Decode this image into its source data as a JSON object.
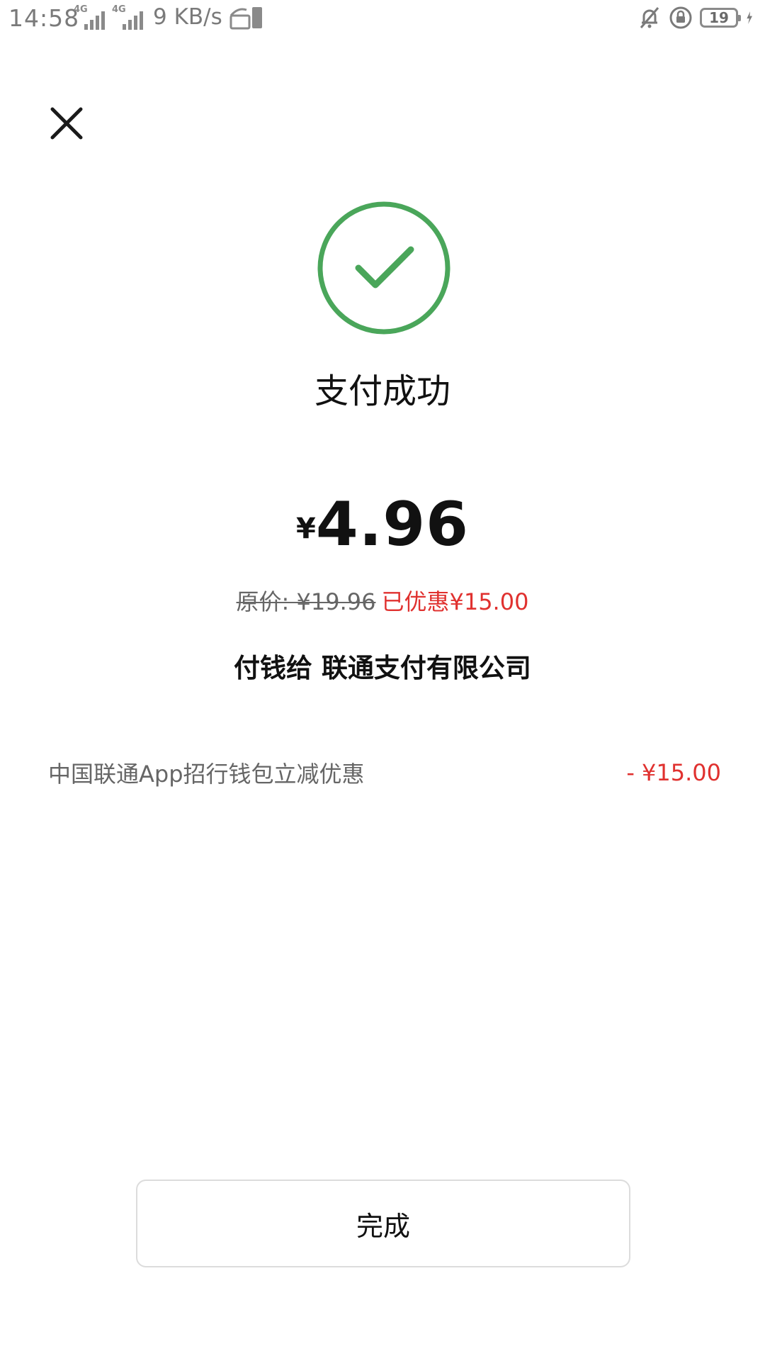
{
  "status_bar": {
    "time": "14:58",
    "network_type_1": "4G",
    "network_type_2": "4G",
    "speed": "9 KB/s",
    "battery_level": "19",
    "icons": [
      "signal-icon",
      "hd-voice-icon",
      "mute-bell-icon",
      "rotation-lock-icon",
      "battery-icon",
      "charging-icon"
    ]
  },
  "header": {
    "close_icon": "close-icon"
  },
  "result": {
    "status_icon": "success-check-icon",
    "title": "支付成功",
    "currency_symbol": "¥",
    "amount": "4.96",
    "original_price": "原价: ¥19.96",
    "discount_text": "已优惠¥15.00",
    "payee": "付钱给 联通支付有限公司"
  },
  "discounts": [
    {
      "name": "中国联通App招行钱包立减优惠",
      "amount": "- ¥15.00"
    }
  ],
  "actions": {
    "done_label": "完成"
  },
  "colors": {
    "success_green": "#4aa65a",
    "discount_red": "#e0312f",
    "text_primary": "#111111",
    "text_secondary": "#666666"
  }
}
